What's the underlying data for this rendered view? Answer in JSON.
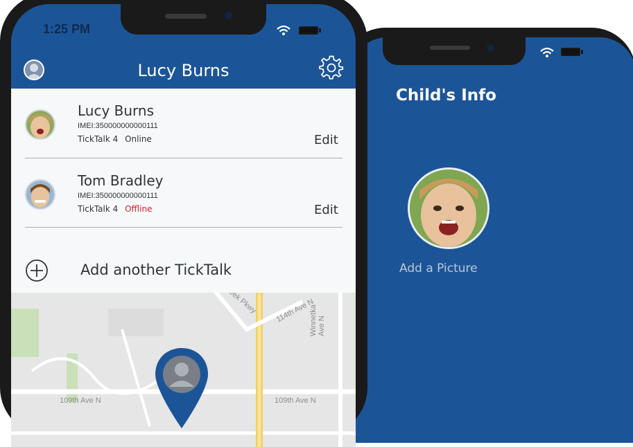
{
  "front_phone": {
    "status_time": "1:25 PM",
    "header_title": "Lucy Burns",
    "devices": [
      {
        "name": "Lucy Burns",
        "imei": "IMEI:350000000000111",
        "model": "TickTalk 4",
        "status": "Online",
        "status_color": "#2f3438",
        "edit_label": "Edit"
      },
      {
        "name": "Tom Bradley",
        "imei": "IMEI:350000000000111",
        "model": "TickTalk 4",
        "status": "Offline",
        "status_color": "#e0202a",
        "edit_label": "Edit"
      }
    ],
    "add_label": "Add another TickTalk",
    "map": {
      "streets": [
        "109th Ave N",
        "109th Ave N",
        "Winnetka Ave N",
        "114th Ave N",
        "Creek Pkwy"
      ]
    }
  },
  "back_phone": {
    "title": "Child's Info",
    "caption": "Add a Picture"
  },
  "colors": {
    "brand_blue": "#1c5597",
    "phone_frame": "#1a1a1a",
    "offline_red": "#e0202a"
  },
  "icons": [
    "profile-icon",
    "gear-icon",
    "add-circle-icon",
    "wifi-icon",
    "battery-icon",
    "location-pin-icon"
  ]
}
